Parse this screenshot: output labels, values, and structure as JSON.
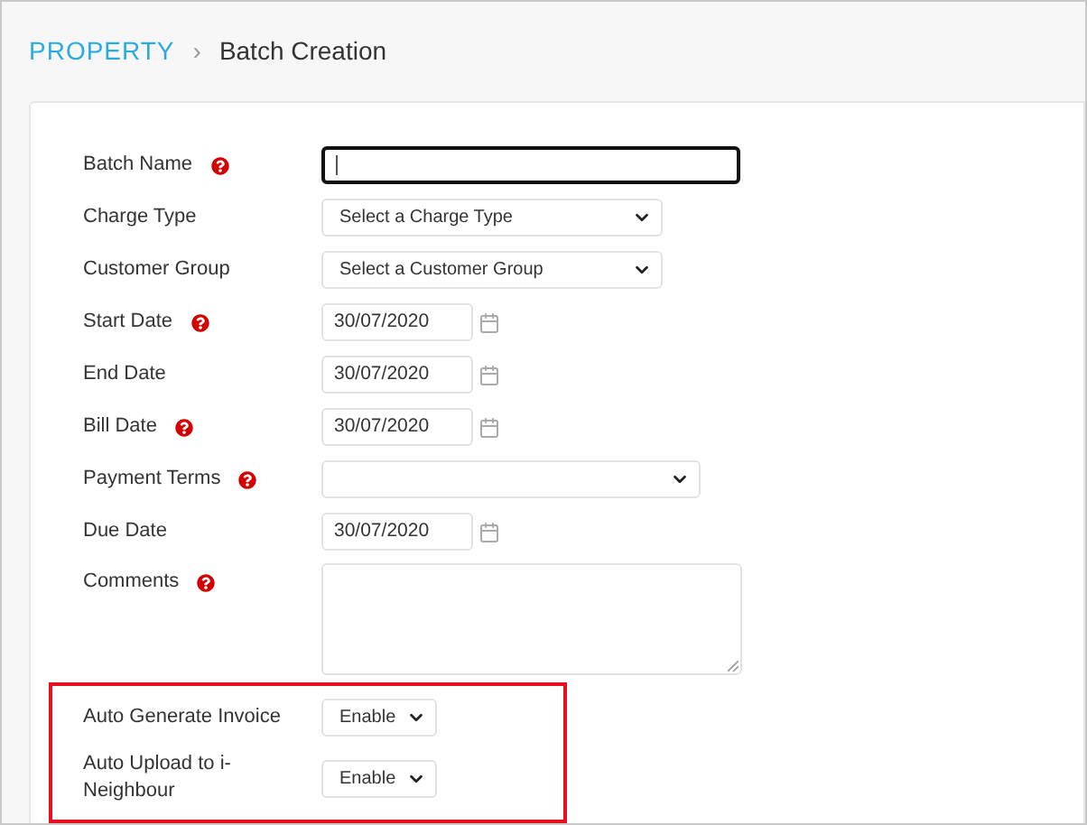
{
  "breadcrumb": {
    "parent": "PROPERTY",
    "separator": "›",
    "current": "Batch Creation"
  },
  "fields": [
    {
      "kind": "text",
      "label": "Batch Name",
      "help": true,
      "focused": true
    },
    {
      "kind": "select",
      "label": "Charge Type",
      "help": false,
      "value": "Select a Charge Type"
    },
    {
      "kind": "select",
      "label": "Customer Group",
      "help": false,
      "value": "Select a Customer Group"
    },
    {
      "kind": "date",
      "label": "Start Date",
      "help": true,
      "value": "30/07/2020"
    },
    {
      "kind": "date",
      "label": "End Date",
      "help": false,
      "value": "30/07/2020"
    },
    {
      "kind": "date",
      "label": "Bill Date",
      "help": true,
      "value": "30/07/2020"
    },
    {
      "kind": "wideselect",
      "label": "Payment Terms",
      "help": true
    },
    {
      "kind": "date",
      "label": "Due Date",
      "help": false,
      "value": "30/07/2020"
    },
    {
      "kind": "textarea",
      "label": "Comments",
      "help": true
    }
  ],
  "highlighted_fields": [
    {
      "kind": "smallselect",
      "label": "Auto Generate Invoice",
      "value": "Enable"
    },
    {
      "kind": "smallselect",
      "label": "Auto Upload to i-Neighbour",
      "value": "Enable"
    }
  ]
}
